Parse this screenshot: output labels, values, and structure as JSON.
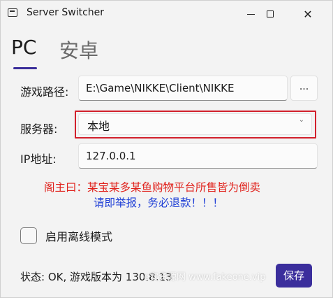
{
  "window": {
    "title": "Server Switcher"
  },
  "tabs": [
    {
      "label": "PC",
      "selected": true
    },
    {
      "label": "安卓",
      "selected": false
    }
  ],
  "form": {
    "game_path_label": "游戏路径:",
    "game_path_value": "E:\\Game\\NIKKE\\Client\\NIKKE",
    "browse_label": "...",
    "server_label": "服务器:",
    "server_value": "本地",
    "ip_label": "IP地址:",
    "ip_value": "127.0.0.1"
  },
  "notice": {
    "line1": "阁主曰：某宝某多某鱼购物平台所售皆为倒卖",
    "line2": "请即举报，务必退款！！！"
  },
  "offline_mode": {
    "label": "启用离线模式",
    "checked": false
  },
  "status_text": "状态: OK, 游戏版本为 130.8.13",
  "watermark_text": "e安资源网 www.fakeone.vip",
  "save_label": "保存",
  "colors": {
    "accent": "#3b2e9c",
    "notice_red": "#e0211b",
    "notice_blue": "#1f3fd6",
    "highlight_border": "#d2202c"
  }
}
